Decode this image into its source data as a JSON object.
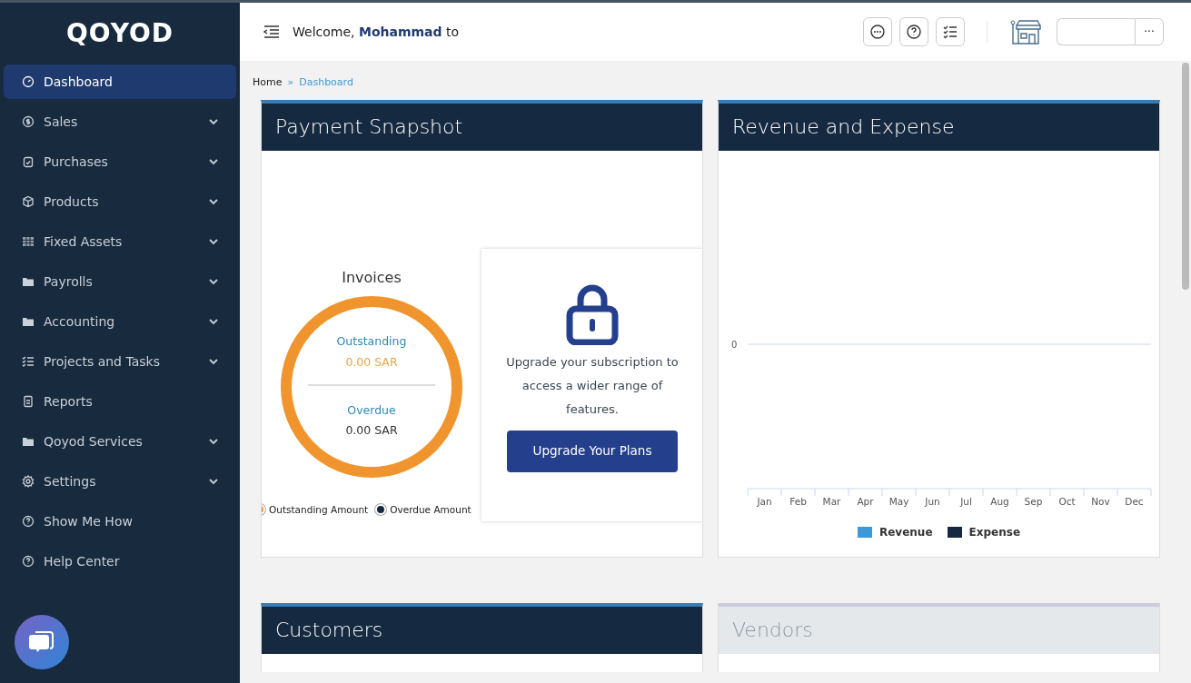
{
  "logo": "QOYOD",
  "sidebar": {
    "items": [
      {
        "label": "Dashboard",
        "selected": true,
        "expandable": false
      },
      {
        "label": "Sales",
        "selected": false,
        "expandable": true
      },
      {
        "label": "Purchases",
        "selected": false,
        "expandable": true
      },
      {
        "label": "Products",
        "selected": false,
        "expandable": true
      },
      {
        "label": "Fixed Assets",
        "selected": false,
        "expandable": true
      },
      {
        "label": "Payrolls",
        "selected": false,
        "expandable": true
      },
      {
        "label": "Accounting",
        "selected": false,
        "expandable": true
      },
      {
        "label": "Projects and Tasks",
        "selected": false,
        "expandable": true
      },
      {
        "label": "Reports",
        "selected": false,
        "expandable": false
      },
      {
        "label": "Qoyod Services",
        "selected": false,
        "expandable": true
      },
      {
        "label": "Settings",
        "selected": false,
        "expandable": true
      },
      {
        "label": "Show Me How",
        "selected": false,
        "expandable": false
      },
      {
        "label": "Help Center",
        "selected": false,
        "expandable": false
      }
    ]
  },
  "topbar": {
    "welcome": "Welcome, **Mohammad** to",
    "more": "···"
  },
  "breadcrumb": [
    {
      "label": "Home",
      "sep": "»"
    },
    {
      "label": "Dashboard"
    }
  ],
  "payment_snapshot": {
    "title": "Payment Snapshot",
    "invoices": {
      "title": "Invoices",
      "outstanding_label": "Outstanding",
      "outstanding_value": "0.00 SAR",
      "overdue_label": "Overdue",
      "overdue_value": "0.00 SAR"
    },
    "legend": [
      {
        "label": "Outstanding Amount",
        "color": "#f0952e"
      },
      {
        "label": "Overdue Amount",
        "color": "#152940"
      }
    ],
    "lock": {
      "message": "Upgrade your subscription to access a wider range of features.",
      "button": "Upgrade Your Plans"
    }
  },
  "revenue_expense": {
    "title": "Revenue and Expense",
    "axis_label": "0",
    "months": [
      "Jan",
      "Feb",
      "Mar",
      "Apr",
      "May",
      "Jun",
      "Jul",
      "Aug",
      "Sep",
      "Oct",
      "Nov",
      "Dec"
    ],
    "legend": [
      {
        "name": "Revenue",
        "color": "#3a9ad9"
      },
      {
        "name": "Expense",
        "color": "#152940"
      }
    ]
  },
  "bottom_cards": [
    {
      "title": "Customers",
      "disabled": false
    },
    {
      "title": "Vendors",
      "disabled": true
    }
  ]
}
